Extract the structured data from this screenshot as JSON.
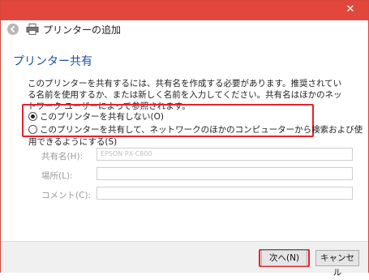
{
  "header": {
    "title": "プリンターの追加"
  },
  "section": {
    "title": "プリンター共有",
    "description": "このプリンターを共有するには、共有名を作成する必要があります。推奨されている名前を使用するか、または新しく名前を入力してください。共有名はほかのネットワーク ユーザーによって参照されます。"
  },
  "options": [
    {
      "label": "このプリンターを共有しない(O)",
      "selected": true
    },
    {
      "label": "このプリンターを共有して、ネットワークのほかのコンピューターから検索および使用できるようにする(S)",
      "selected": false
    }
  ],
  "fields": [
    {
      "label": "共有名(H):",
      "value": "EPSON PX-C800"
    },
    {
      "label": "場所(L):",
      "value": ""
    },
    {
      "label": "コメント(C):",
      "value": ""
    }
  ],
  "buttons": {
    "next": "次へ(N)",
    "cancel": "キャンセル"
  },
  "titlebar": {
    "close": "✕"
  },
  "colors": {
    "titlebar": "#e3473b",
    "highlight": "#e3232b",
    "section_title": "#1c4fa0"
  }
}
